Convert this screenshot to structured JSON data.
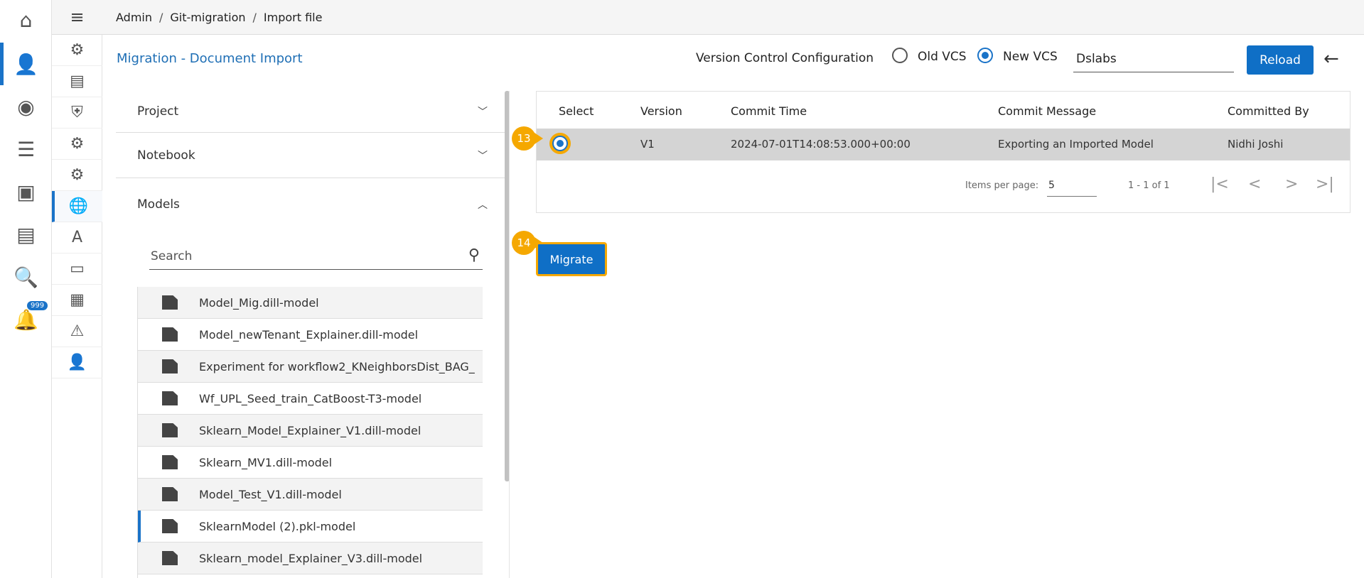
{
  "breadcrumb": [
    "Admin",
    "Git-migration",
    "Import file"
  ],
  "page_title": "Migration - Document Import",
  "vcs": {
    "label": "Version Control Configuration",
    "options": [
      "Old VCS",
      "New VCS"
    ],
    "selected": "New VCS",
    "repo_value": "Dslabs",
    "reload_label": "Reload"
  },
  "rail_icons": [
    "home-icon",
    "user-settings-icon",
    "user-info-icon",
    "database-network-icon",
    "presentation-user-icon",
    "data-catalog-icon",
    "data-search-icon",
    "bell-icon"
  ],
  "notification_count": "999",
  "submenu_icons": [
    "award-user-icon",
    "billing-icon",
    "shield-lock-icon",
    "gears-icon",
    "file-gear-icon",
    "globe-cloud-sync-icon",
    "translate-icon",
    "certificate-icon",
    "calendar-search-icon",
    "server-warning-icon",
    "user-clock-icon"
  ],
  "accordion": {
    "project": "Project",
    "notebook": "Notebook",
    "models": "Models"
  },
  "search": {
    "placeholder": "Search"
  },
  "models": [
    "Model_Mig.dill-model",
    "Model_newTenant_Explainer.dill-model",
    "Experiment for workflow2_KNeighborsDist_BAG_",
    "Wf_UPL_Seed_train_CatBoost-T3-model",
    "Sklearn_Model_Explainer_V1.dill-model",
    "Sklearn_MV1.dill-model",
    "Model_Test_V1.dill-model",
    "SklearnModel (2).pkl-model",
    "Sklearn_model_Explainer_V3.dill-model"
  ],
  "table": {
    "headers": [
      "Select",
      "Version",
      "Commit Time",
      "Commit Message",
      "Committed By"
    ],
    "rows": [
      {
        "version": "V1",
        "commit_time": "2024-07-01T14:08:53.000+00:00",
        "message": "Exporting an Imported Model",
        "by": "Nidhi Joshi"
      }
    ]
  },
  "pagination": {
    "items_label": "Items per page:",
    "items_value": "5",
    "range": "1 - 1 of 1"
  },
  "steps": [
    "13",
    "14"
  ],
  "migrate_label": "Migrate"
}
